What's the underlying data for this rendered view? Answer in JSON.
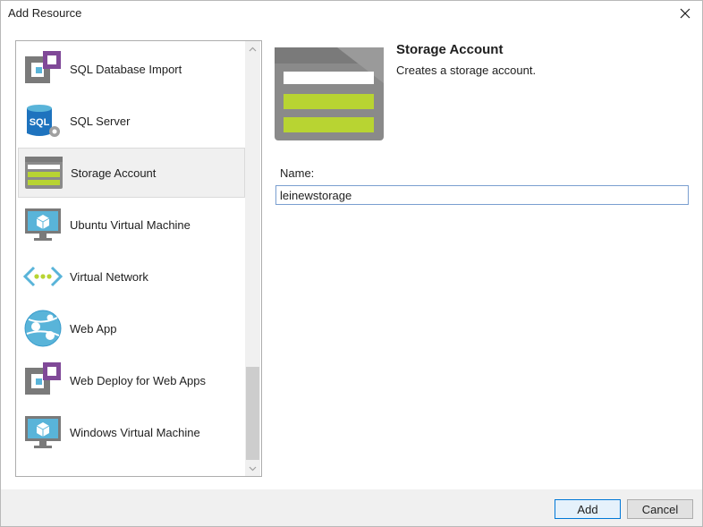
{
  "window": {
    "title": "Add Resource"
  },
  "resource_list": {
    "items": [
      {
        "label": "SQL Database Import",
        "icon": "sql-database-import-icon",
        "selected": false
      },
      {
        "label": "SQL Server",
        "icon": "sql-server-icon",
        "selected": false
      },
      {
        "label": "Storage Account",
        "icon": "storage-account-icon",
        "selected": true
      },
      {
        "label": "Ubuntu Virtual Machine",
        "icon": "ubuntu-vm-icon",
        "selected": false
      },
      {
        "label": "Virtual Network",
        "icon": "virtual-network-icon",
        "selected": false
      },
      {
        "label": "Web App",
        "icon": "web-app-icon",
        "selected": false
      },
      {
        "label": "Web Deploy for Web Apps",
        "icon": "web-deploy-icon",
        "selected": false
      },
      {
        "label": "Windows Virtual Machine",
        "icon": "windows-vm-icon",
        "selected": false
      }
    ]
  },
  "detail": {
    "title": "Storage Account",
    "description": "Creates a storage account.",
    "icon": "storage-account-icon",
    "name_label": "Name:",
    "name_value": "leinewstorage"
  },
  "buttons": {
    "add": "Add",
    "cancel": "Cancel"
  },
  "colors": {
    "accent_blue": "#0078d7",
    "storage_green": "#b8d432",
    "azure_purple": "#804998",
    "azure_blue": "#59b4d9"
  }
}
